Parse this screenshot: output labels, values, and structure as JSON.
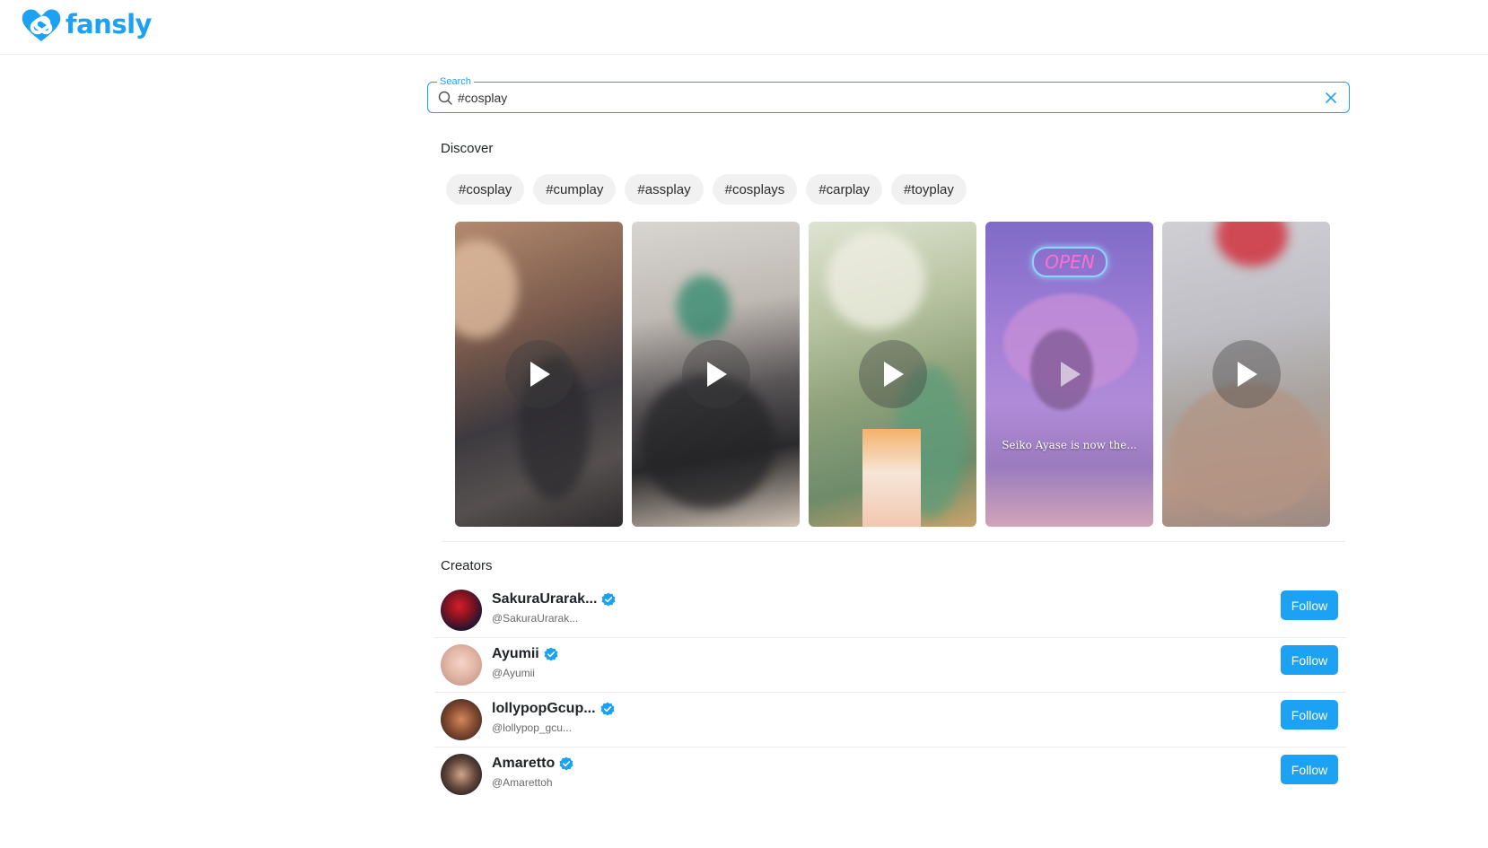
{
  "header": {
    "logo_text": "fansly"
  },
  "search": {
    "label": "Search",
    "value": "#cosplay"
  },
  "discover": {
    "title": "Discover",
    "tags": [
      "#cosplay",
      "#cumplay",
      "#assplay",
      "#cosplays",
      "#carplay",
      "#toyplay"
    ],
    "videos": [
      {
        "caption": ""
      },
      {
        "caption": ""
      },
      {
        "caption": ""
      },
      {
        "caption": "Seiko Ayase is now the...",
        "neon_text": "OPEN"
      },
      {
        "caption": ""
      }
    ]
  },
  "creators": {
    "title": "Creators",
    "list": [
      {
        "name": "SakuraUrarak...",
        "handle": "@SakuraUrarak...",
        "follow_label": "Follow"
      },
      {
        "name": "Ayumii",
        "handle": "@Ayumii",
        "follow_label": "Follow"
      },
      {
        "name": "lollypopGcup...",
        "handle": "@lollypop_gcu...",
        "follow_label": "Follow"
      },
      {
        "name": "Amaretto",
        "handle": "@Amarettoh",
        "follow_label": "Follow"
      }
    ]
  },
  "colors": {
    "accent": "#1da1f2",
    "chip_bg": "#f1f1f1",
    "divider": "#ececec"
  },
  "icons": {
    "logo": "heart-logo-icon",
    "search": "search-icon",
    "clear": "close-icon",
    "play": "play-icon",
    "verified": "verified-badge-icon"
  }
}
